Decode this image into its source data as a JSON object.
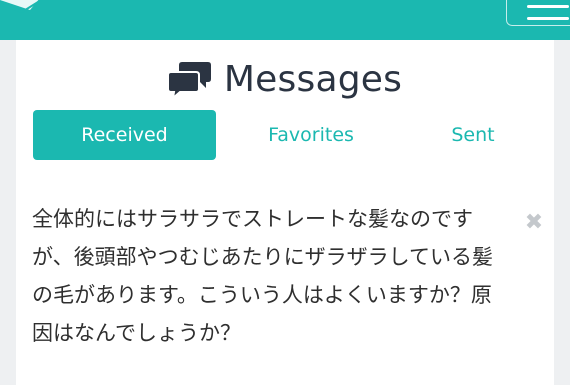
{
  "header": {
    "title": "Messages",
    "icon": "chat-bubbles-icon"
  },
  "tabs": [
    {
      "label": "Received",
      "active": true
    },
    {
      "label": "Favorites",
      "active": false
    },
    {
      "label": "Sent",
      "active": false
    }
  ],
  "message": {
    "text": "全体的にはサラサラでストレートな髪なのですが、後頭部やつむじあたりにザラザラしている髪の毛があります。こういう人はよくいますか？原因はなんでしょうか？",
    "close_symbol": "✖"
  },
  "colors": {
    "accent": "#1bb8b0",
    "title": "#2b3442",
    "text": "#2f2f2f",
    "close": "#c4c8cc"
  }
}
